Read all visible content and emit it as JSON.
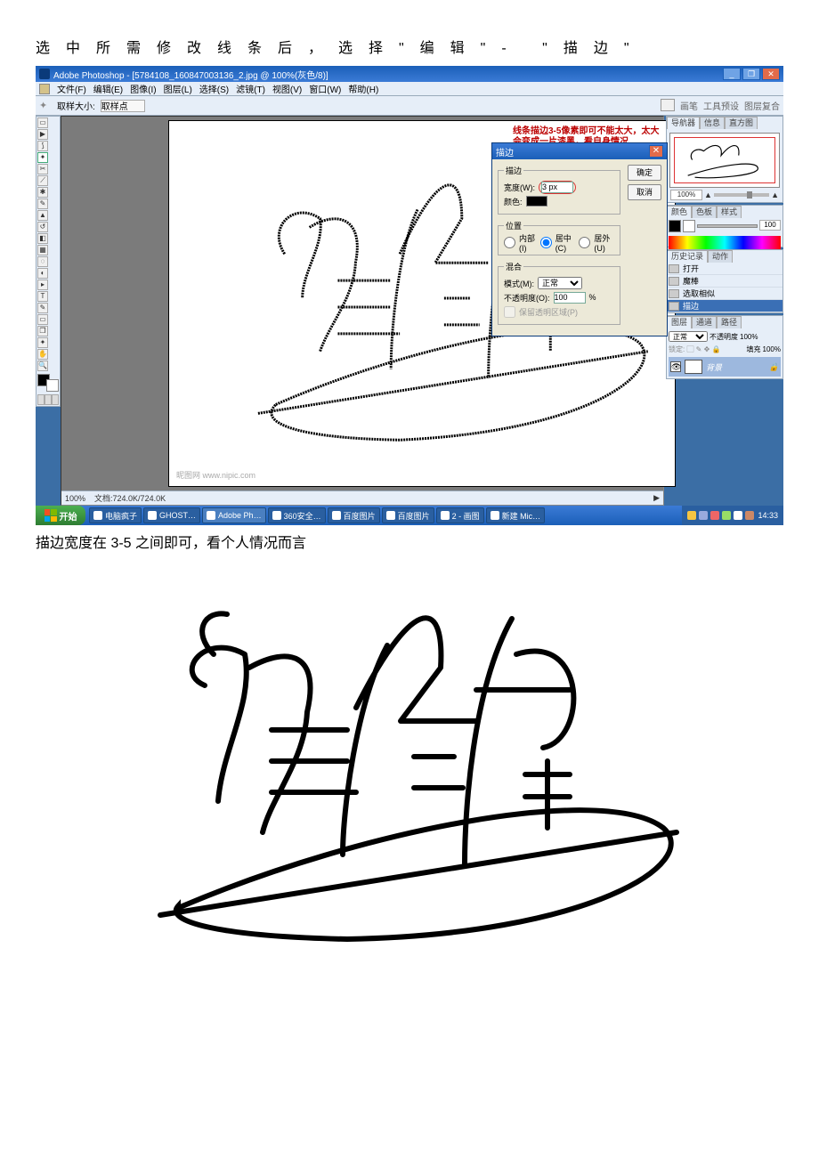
{
  "doc": {
    "instruction": "选中所需修改线条后，选择\"编辑\"- \"描边\"",
    "caption": "描边宽度在 3-5 之间即可，看个人情况而言"
  },
  "ps": {
    "title": "Adobe Photoshop - [5784108_160847003136_2.jpg @ 100%(灰色/8)]",
    "menus": [
      "文件(F)",
      "编辑(E)",
      "图像(I)",
      "图层(L)",
      "选择(S)",
      "滤镜(T)",
      "视图(V)",
      "窗口(W)",
      "帮助(H)"
    ],
    "optionbar": {
      "label": "取样大小:",
      "value": "取样点",
      "docks": [
        "画笔",
        "工具预设",
        "图层复合"
      ]
    },
    "canvas_hint": "线条描边3-5像素即可不能太大，太大会变成一片漆黑，看自身情况",
    "watermark": "昵图网 www.nipic.com",
    "status": {
      "zoom": "100%",
      "doc": "文档:724.0K/724.0K"
    },
    "navigator": {
      "tabs": [
        "导航器",
        "信息",
        "直方图"
      ],
      "pct": "100%"
    },
    "color": {
      "tabs": [
        "颜色",
        "色板",
        "样式"
      ]
    },
    "history": {
      "tabs": [
        "历史记录",
        "动作"
      ],
      "items": [
        "打开",
        "魔棒",
        "选取相似",
        "描边"
      ]
    },
    "layers": {
      "tabs": [
        "图层",
        "通道",
        "路径"
      ],
      "mode_label": "正常",
      "opacity_label": "不透明度",
      "opacity_val": "100%",
      "fill_label": "填充",
      "fill_val": "100%",
      "layer_name": "背景"
    }
  },
  "dialog": {
    "title": "描边",
    "ok": "确定",
    "cancel": "取消",
    "stroke_group": "描边",
    "width_label": "宽度(W):",
    "width_value": "3 px",
    "color_label": "颜色:",
    "position_group": "位置",
    "pos_inside": "内部(I)",
    "pos_center": "居中(C)",
    "pos_outside": "居外(U)",
    "blend_group": "混合",
    "mode_label": "模式(M):",
    "mode_value": "正常",
    "opacity_label": "不透明度(O):",
    "opacity_value": "100",
    "opacity_pct": "%",
    "preserve": "保留透明区域(P)"
  },
  "taskbar": {
    "start": "开始",
    "items": [
      "电脑疯子",
      "GHOST…",
      "Adobe Ph…",
      "360安全…",
      "百度图片",
      "百度图片",
      "2 - 画图",
      "新建 Mic…"
    ],
    "active_index": 2,
    "time": "14:33"
  },
  "tray_colors": [
    "#f5c542",
    "#9ad",
    "#e66",
    "#9d6",
    "#fff",
    "#c86"
  ],
  "tool_glyphs": [
    "▭",
    "▶",
    "✥",
    "✂",
    "✎",
    "✱",
    "⟋",
    "◌",
    "△",
    "▲",
    "◧",
    "⬚",
    "✦",
    "T",
    "✎",
    "◇",
    "✋",
    "🔍",
    "⬛",
    "⬜"
  ]
}
